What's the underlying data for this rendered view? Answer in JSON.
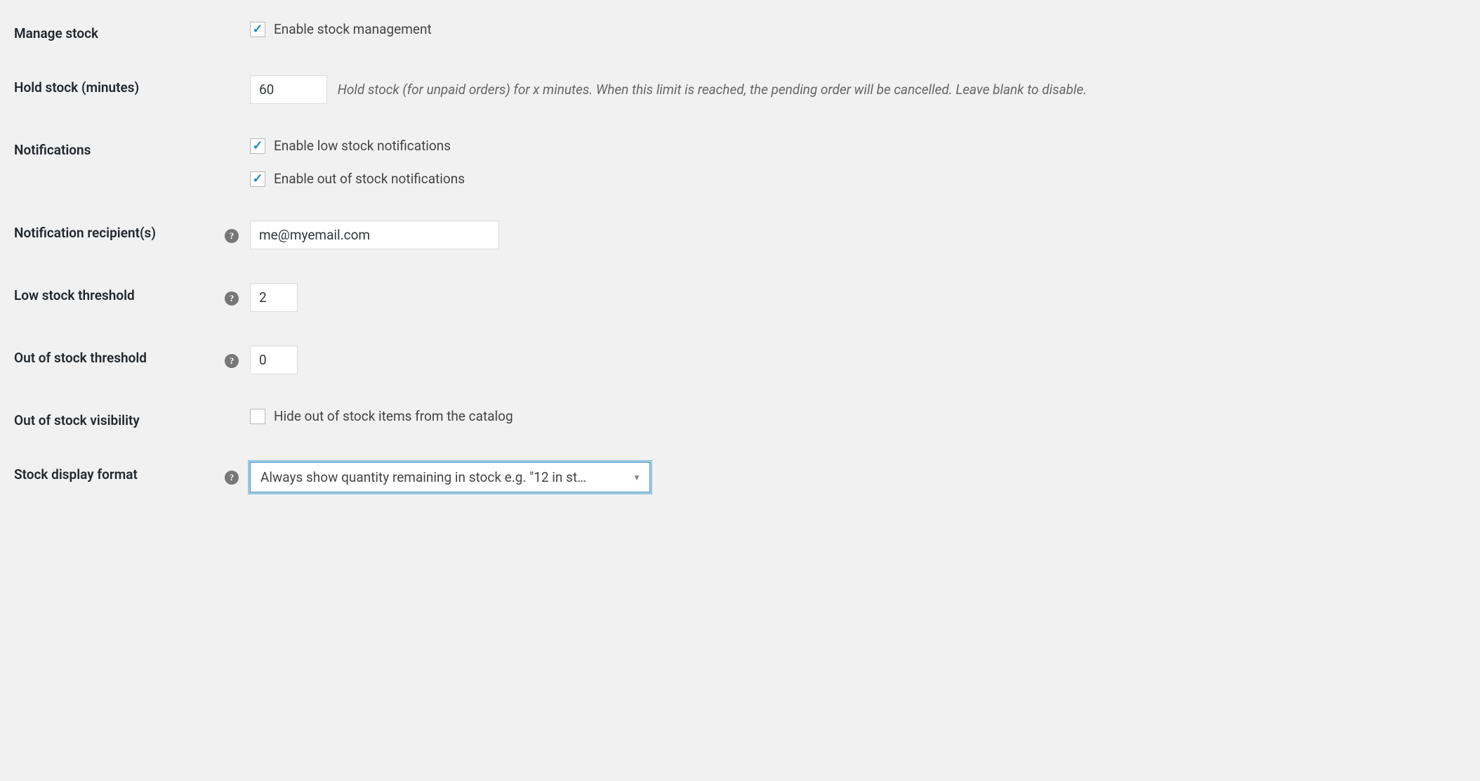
{
  "rows": {
    "manageStock": {
      "label": "Manage stock",
      "checkbox": {
        "checked": true,
        "text": "Enable stock management"
      }
    },
    "holdStock": {
      "label": "Hold stock (minutes)",
      "value": "60",
      "help": "Hold stock (for unpaid orders) for x minutes. When this limit is reached, the pending order will be cancelled. Leave blank to disable."
    },
    "notifications": {
      "label": "Notifications",
      "lowStock": {
        "checked": true,
        "text": "Enable low stock notifications"
      },
      "outOfStock": {
        "checked": true,
        "text": "Enable out of stock notifications"
      }
    },
    "recipients": {
      "label": "Notification recipient(s)",
      "value": "me@myemail.com"
    },
    "lowThreshold": {
      "label": "Low stock threshold",
      "value": "2"
    },
    "outThreshold": {
      "label": "Out of stock threshold",
      "value": "0"
    },
    "visibility": {
      "label": "Out of stock visibility",
      "checkbox": {
        "checked": false,
        "text": "Hide out of stock items from the catalog"
      }
    },
    "displayFormat": {
      "label": "Stock display format",
      "selected": "Always show quantity remaining in stock e.g. \"12 in st…"
    }
  }
}
